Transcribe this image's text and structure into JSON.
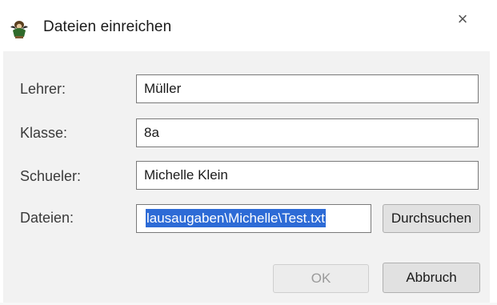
{
  "window": {
    "title": "Dateien einreichen",
    "app_icon": "fairy-wizard-icon",
    "close_glyph": "×"
  },
  "form": {
    "teacher_label": "Lehrer:",
    "teacher_value": "Müller",
    "class_label": "Klasse:",
    "class_value": "8a",
    "student_label": "Schueler:",
    "student_value": "Michelle Klein",
    "files_label": "Dateien:",
    "files_value": "lausaugaben\\Michelle\\Test.txt",
    "browse_button": "Durchsuchen"
  },
  "buttons": {
    "ok": "OK",
    "cancel": "Abbruch"
  },
  "colors": {
    "selection": "#2d6bd6",
    "client_bg": "#f2f2f2",
    "disabled_text": "#9a9a9a"
  }
}
